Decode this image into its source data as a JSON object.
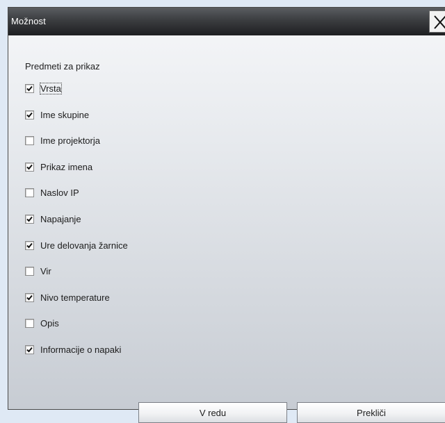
{
  "window": {
    "title": "Možnost",
    "close_label": "X"
  },
  "group": {
    "label": "Predmeti za prikaz"
  },
  "options": [
    {
      "label": "Vrsta",
      "checked": true
    },
    {
      "label": "Ime skupine",
      "checked": true
    },
    {
      "label": "Ime projektorja",
      "checked": false
    },
    {
      "label": "Prikaz imena",
      "checked": true
    },
    {
      "label": "Naslov IP",
      "checked": false
    },
    {
      "label": "Napajanje",
      "checked": true
    },
    {
      "label": "Ure delovanja žarnice",
      "checked": true
    },
    {
      "label": "Vir",
      "checked": false
    },
    {
      "label": "Nivo temperature",
      "checked": true
    },
    {
      "label": "Opis",
      "checked": false
    },
    {
      "label": "Informacije o napaki",
      "checked": true
    }
  ],
  "buttons": {
    "ok_label": "V redu",
    "cancel_label": "Prekliči"
  },
  "colors": {
    "titlebar": "#2c2e31",
    "background": "#dfe9f5"
  }
}
